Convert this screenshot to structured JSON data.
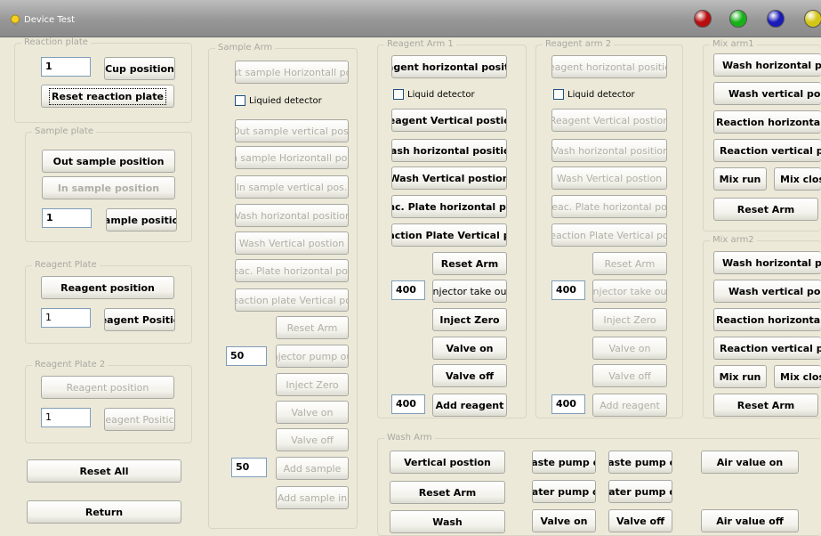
{
  "window": {
    "title": "Device Test",
    "dot_colors": [
      "#b80d0d",
      "#17b217",
      "#1a1ab8",
      "#d4c616"
    ]
  },
  "reaction_plate": {
    "legend": "Reaction plate",
    "value": "1",
    "cup_position": "Cup position",
    "reset": "Reset reaction plate"
  },
  "sample_plate": {
    "legend": "Sample plate",
    "out_sample_position": "Out sample position",
    "in_sample_position": "In sample position",
    "value": "1",
    "sample_position": "ample positio"
  },
  "reagent_plate": {
    "legend": "Reagent Plate",
    "reagent_position": "Reagent position",
    "value": "1",
    "reagent_position_btn": "eagent Positic"
  },
  "reagent_plate2": {
    "legend": "Reagent Plate 2",
    "reagent_position": "Reagent position",
    "value": "1",
    "reagent_position_btn": "eagent Positic"
  },
  "left_buttons": {
    "reset_all": "Reset All",
    "return": "Return"
  },
  "sample_arm": {
    "legend": "Sample Arm",
    "buttons": [
      "ut sample Horizontall po",
      "Out sample vertical pos.",
      "n sample Horizontall pos",
      "In sample vertical pos.",
      "Vash horizontal positior",
      "Wash Vertical postion",
      "eac. Plate horizontal po:",
      "eaction plate Vertical po"
    ],
    "liquid_detector": "Liquied detector",
    "reset_arm": "Reset Arm",
    "injector_value": "50",
    "injector_pump": "njector pump ou",
    "inject_zero": "Inject Zero",
    "valve_on": "Valve on",
    "valve_off": "Valve off",
    "sample_value": "50",
    "add_sample": "Add sample",
    "add_sample_in": "Add sample in"
  },
  "reagent_arm1": {
    "legend": "Reagent Arm 1",
    "buttons": [
      "eagent horizontal positic",
      "Reagent Vertical postion",
      "Vash horizontal positior",
      "Wash Vertical postion",
      "eac. Plate horizontal po:",
      "eaction Plate Vertical po"
    ],
    "liquid_detector": "Liquid detector",
    "reset_arm": "Reset Arm",
    "injector_value": "400",
    "injector_take": "njector take ou",
    "inject_zero": "Inject Zero",
    "valve_on": "Valve on",
    "valve_off": "Valve off",
    "reagent_value": "400",
    "add_reagent": "Add reagent"
  },
  "reagent_arm2": {
    "legend": "Reagent arm 2",
    "buttons": [
      "eagent horizontal positic",
      "Reagent Vertical postion",
      "Vash horizontal positior",
      "Wash Vertical postion",
      "eac. Plate horizontal po",
      "eaction Plate Vertical po"
    ],
    "liquid_detector": "Liquid detector",
    "reset_arm": "Reset Arm",
    "injector_value": "400",
    "injector_take": "njector take ou",
    "inject_zero": "Inject Zero",
    "valve_on": "Valve on",
    "valve_off": "Valve off",
    "reagent_value": "400",
    "add_reagent": "Add reagent"
  },
  "mix_arm1": {
    "legend": "Mix arm1",
    "wash_horizontal": "Wash horizontal pos.",
    "wash_vertical": "Wash vertical pos.",
    "reaction_horizontal": "Reaction horizontal po",
    "reaction_vertical": "Reaction vertical pos.",
    "mix_run": "Mix run",
    "mix_close": "Mix close",
    "reset_arm": "Reset Arm"
  },
  "mix_arm2": {
    "legend": "Mix arm2",
    "wash_horizontal": "Wash horizontal pos.",
    "wash_vertical": "Wash vertical pos.",
    "reaction_horizontal": "Reaction horizontal po",
    "reaction_vertical": "Reaction vertical pos.",
    "mix_run": "Mix run",
    "mix_close": "Mix close",
    "reset_arm": "Reset Arm"
  },
  "wash_arm": {
    "legend": "Wash Arm",
    "vertical_position": "Vertical postion",
    "reset_arm": "Reset Arm",
    "wash": "Wash",
    "waste_pump_on": "'aste pump o",
    "waste_pump_off": "'aste pump o",
    "water_pump_on": "'ater pump o",
    "water_pump_off": "/ater pump o",
    "valve_on": "Valve on",
    "valve_off": "Valve off",
    "air_valve_on": "Air value on",
    "air_valve_off": "Air value off"
  }
}
